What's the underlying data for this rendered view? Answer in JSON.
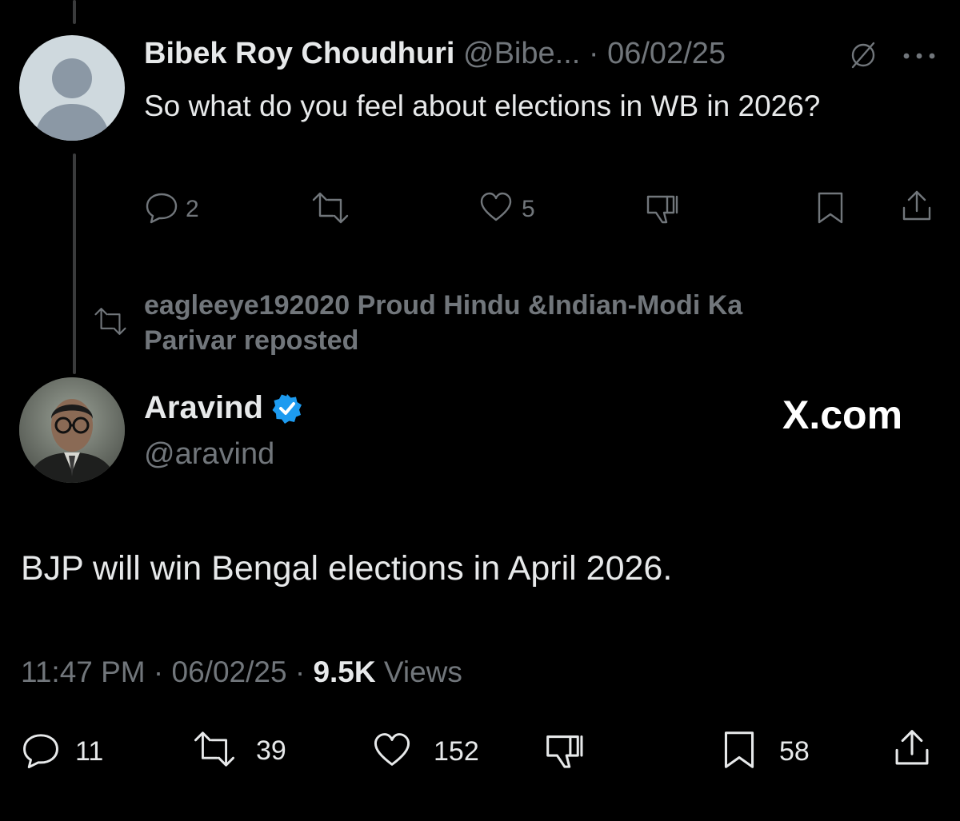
{
  "reply": {
    "author_name": "Bibek Roy Choudhuri",
    "author_handle": "@Bibe...",
    "separator": "·",
    "date": "06/02/25",
    "text": "So what do you feel about elections in WB in 2026?",
    "actions": {
      "replies": "2",
      "likes": "5"
    }
  },
  "repost": {
    "text_line1": "eagleeye192020 Proud Hindu &Indian-Modi Ka",
    "text_line2": "Parivar reposted"
  },
  "main": {
    "author_name": "Aravind",
    "author_handle": "@aravind",
    "watermark": "X.com",
    "text": "BJP will win Bengal elections in April 2026.",
    "meta": {
      "time": "11:47 PM",
      "sep1": "·",
      "date": "06/02/25",
      "sep2": "·",
      "views_count": "9.5K",
      "views_label": "Views"
    },
    "actions": {
      "replies": "11",
      "reposts": "39",
      "likes": "152",
      "bookmarks": "58"
    }
  },
  "colors": {
    "background": "#000000",
    "text": "#e7e9ea",
    "muted": "#71767b",
    "verified": "#1d9bf0"
  }
}
